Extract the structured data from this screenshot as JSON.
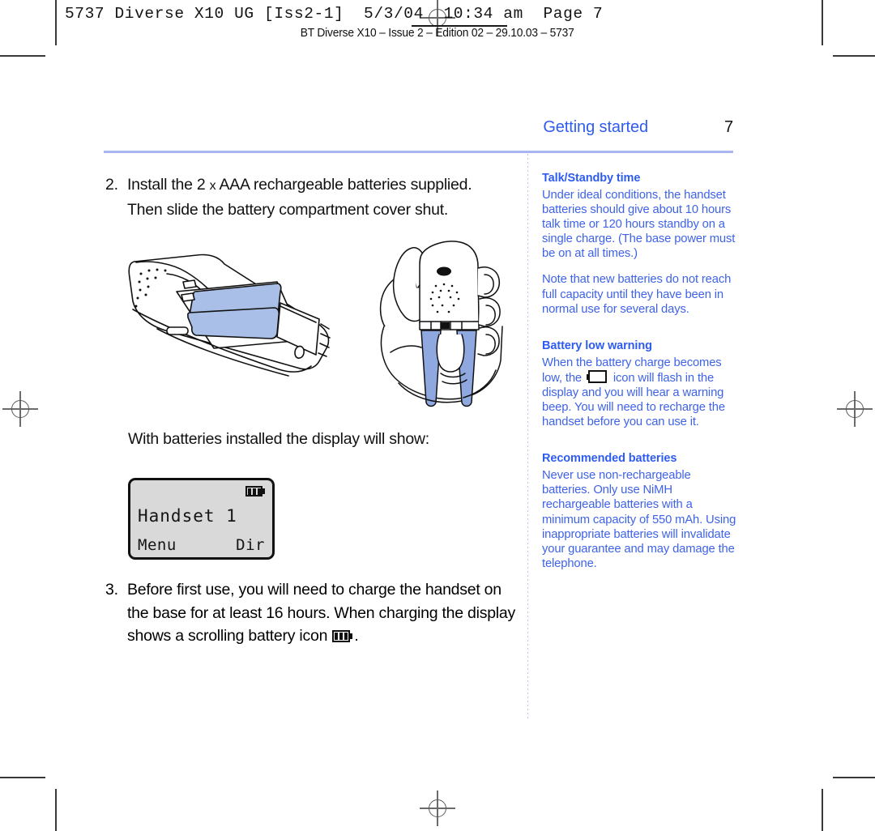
{
  "proof_header": {
    "job_line": "5737 Diverse X10 UG [Iss2-1]  5/3/04  10:34 am  Page 7",
    "caption": "BT Diverse X10 – Issue 2 – Edition 02 – 29.10.03 – 5737"
  },
  "running_head": {
    "section": "Getting started",
    "page_number": "7"
  },
  "main": {
    "step2": {
      "number": "2.",
      "line1_a": "Install the 2 ",
      "line1_x": "x",
      "line1_b": " AAA rechargeable batteries supplied.",
      "line2": "Then slide the battery compartment cover shut."
    },
    "caption_display": "With batteries installed the display will show:",
    "step3": {
      "number": "3.",
      "line1": "Before first use, you will need to charge the handset on",
      "line2": "the base for at least 16 hours. When charging the display",
      "line3_a": "shows a scrolling battery icon ",
      "line3_b": "."
    }
  },
  "lcd": {
    "main_text": "Handset 1",
    "softkey_left": "Menu",
    "softkey_right": "Dir",
    "battery_icon": "battery-full-icon"
  },
  "sidebar": {
    "sections": [
      {
        "heading": "Talk/Standby time",
        "paragraphs": [
          "Under ideal conditions, the handset batteries should give about 10 hours talk time or 120 hours standby on a single charge. (The base power must be on at all times.)",
          "Note that new batteries do not reach full capacity until they have been in normal use for several days."
        ]
      },
      {
        "heading": "Battery low warning",
        "paragraphs": [
          "When the battery charge becomes low, the ",
          " icon will flash in the display and you will hear a warning beep. You will need to recharge the handset before you can use it."
        ],
        "inline_icon": "battery-empty-icon"
      },
      {
        "heading": "Recommended batteries",
        "paragraphs": [
          "Never use non-rechargeable batteries. Only use NiMH rechargeable batteries with a minimum capacity of 550 mAh. Using inappropriate batteries will invalidate your guarantee and may damage the telephone."
        ]
      }
    ]
  },
  "illustrations": {
    "handset_battery_compartment": "handset-battery-compartment-illustration",
    "hand_holding_handset": "hand-holding-handset-illustration"
  },
  "colors": {
    "accent_blue": "#2f5cf0",
    "rule_blue": "#aab4f2",
    "battery_blue": "#9ab0e8",
    "lcd_grey": "#d9d9d9"
  }
}
